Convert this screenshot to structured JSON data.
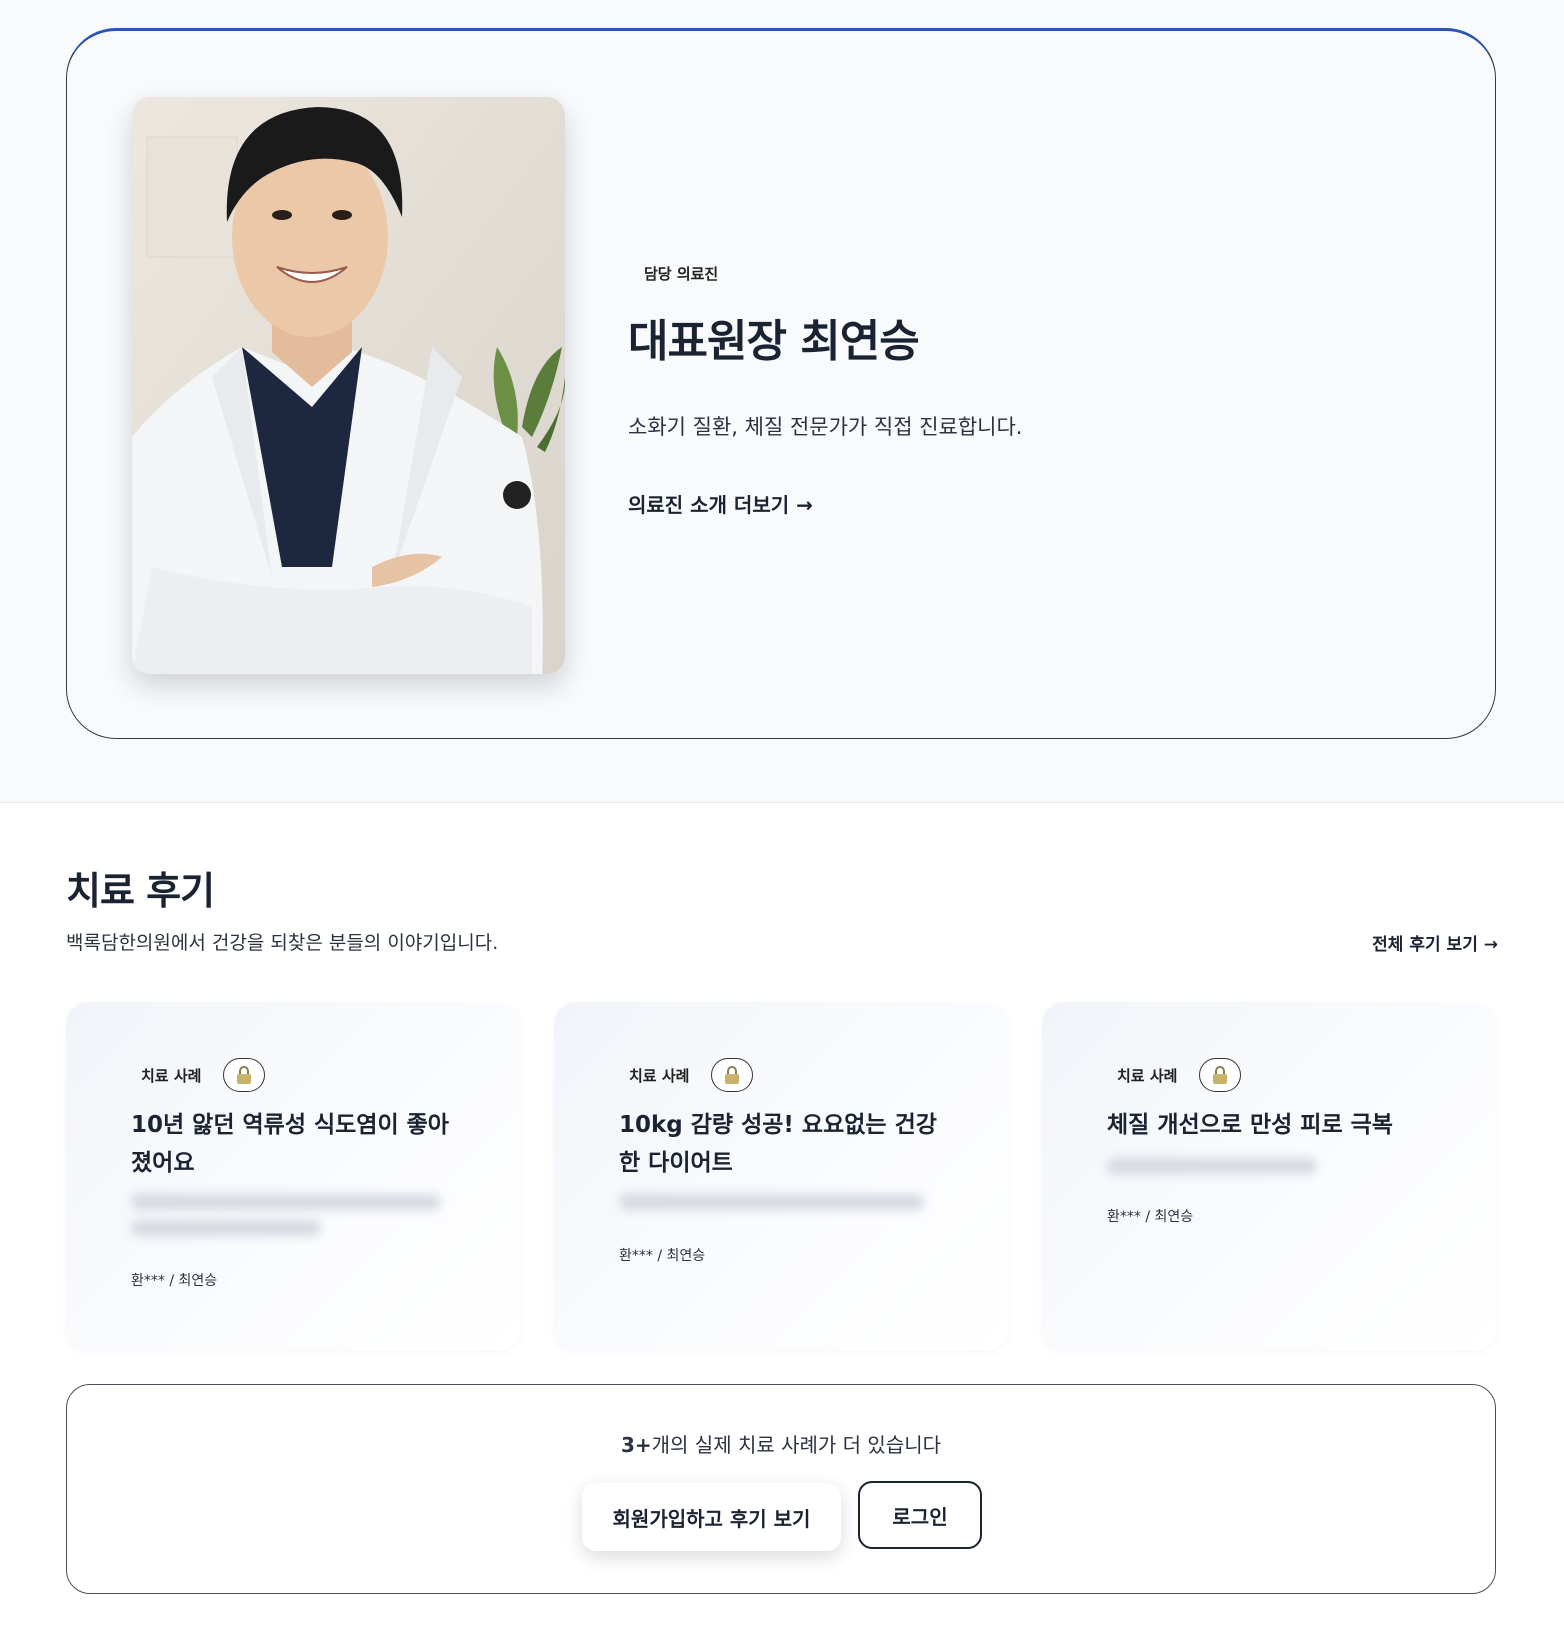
{
  "doctor": {
    "badge": "담당 의료진",
    "name": "대표원장 최연승",
    "description": "소화기 질환, 체질 전문가가 직접 진료합니다.",
    "more_link": "의료진 소개 더보기 →"
  },
  "reviews": {
    "title": "치료 후기",
    "subtitle": "백록담한의원에서 건강을 되찾은 분들의 이야기입니다.",
    "view_all": "전체 후기 보기 →",
    "cards": [
      {
        "tag": "치료 사례",
        "title": "10년 앓던 역류성 식도염이 좋아졌어요",
        "author": "환*** / 최연승",
        "locked": true
      },
      {
        "tag": "치료 사례",
        "title": "10kg 감량 성공! 요요없는 건강한 다이어트",
        "author": "환*** / 최연승",
        "locked": true
      },
      {
        "tag": "치료 사례",
        "title": "체질 개선으로 만성 피로 극복",
        "author": "환*** / 최연승",
        "locked": true
      }
    ]
  },
  "cta": {
    "count": "3+",
    "text": "개의 실제 치료 사례가 더 있습니다",
    "signup_button": "회원가입하고 후기 보기",
    "login_button": "로그인"
  },
  "colors": {
    "accent_border": "#2a56b0",
    "text_dark": "#1b2332",
    "background_light": "#f8fafc"
  }
}
